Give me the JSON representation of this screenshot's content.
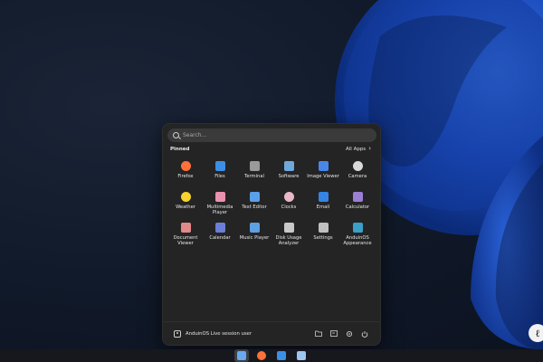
{
  "search": {
    "placeholder": "Search..."
  },
  "pinned": {
    "heading": "Pinned",
    "all_apps_label": "All Apps"
  },
  "apps": [
    {
      "label": "Firefox",
      "icon": "firefox-icon",
      "color": "#ff7139"
    },
    {
      "label": "Files",
      "icon": "files-icon",
      "color": "#3d8ee6"
    },
    {
      "label": "Terminal",
      "icon": "terminal-icon",
      "color": "#9a9a9a"
    },
    {
      "label": "Software",
      "icon": "software-icon",
      "color": "#6fa8dc"
    },
    {
      "label": "Image Viewer",
      "icon": "image-viewer-icon",
      "color": "#4a86e8"
    },
    {
      "label": "Camera",
      "icon": "camera-icon",
      "color": "#d9d9d9"
    },
    {
      "label": "Weather",
      "icon": "weather-icon",
      "color": "#f6d32d"
    },
    {
      "label": "Multimedia Player",
      "icon": "multimedia-player-icon",
      "color": "#e991b0"
    },
    {
      "label": "Text Editor",
      "icon": "text-editor-icon",
      "color": "#5aa0e8"
    },
    {
      "label": "Clocks",
      "icon": "clocks-icon",
      "color": "#e8b8c8"
    },
    {
      "label": "Email",
      "icon": "email-icon",
      "color": "#3584e4"
    },
    {
      "label": "Calculator",
      "icon": "calculator-icon",
      "color": "#9b7fd4"
    },
    {
      "label": "Document Viewer",
      "icon": "document-viewer-icon",
      "color": "#e08a8a"
    },
    {
      "label": "Calendar",
      "icon": "calendar-icon",
      "color": "#6b7fd8"
    },
    {
      "label": "Music Player",
      "icon": "music-player-icon",
      "color": "#5fa0e0"
    },
    {
      "label": "Disk Usage Analyzer",
      "icon": "disk-usage-analyzer-icon",
      "color": "#c8c8c8"
    },
    {
      "label": "Settings",
      "icon": "settings-icon",
      "color": "#bfbfbf"
    },
    {
      "label": "AnduinOS Appearance",
      "icon": "appearance-icon",
      "color": "#3aa0c8"
    }
  ],
  "footer": {
    "user_name": "AnduinOS Live session user",
    "buttons": [
      "folder-icon",
      "file-manager-icon",
      "gear-icon",
      "power-icon"
    ]
  },
  "taskbar": {
    "items": [
      {
        "icon": "start-menu-icon",
        "active": true,
        "color": "#6aa9f0"
      },
      {
        "icon": "firefox-icon",
        "active": false,
        "color": "#ff7139"
      },
      {
        "icon": "files-icon",
        "active": false,
        "color": "#3d8ee6"
      },
      {
        "icon": "text-editor-icon",
        "active": false,
        "color": "#9ec4f0"
      }
    ]
  },
  "corner_badge": {
    "glyph": "ℓ"
  }
}
